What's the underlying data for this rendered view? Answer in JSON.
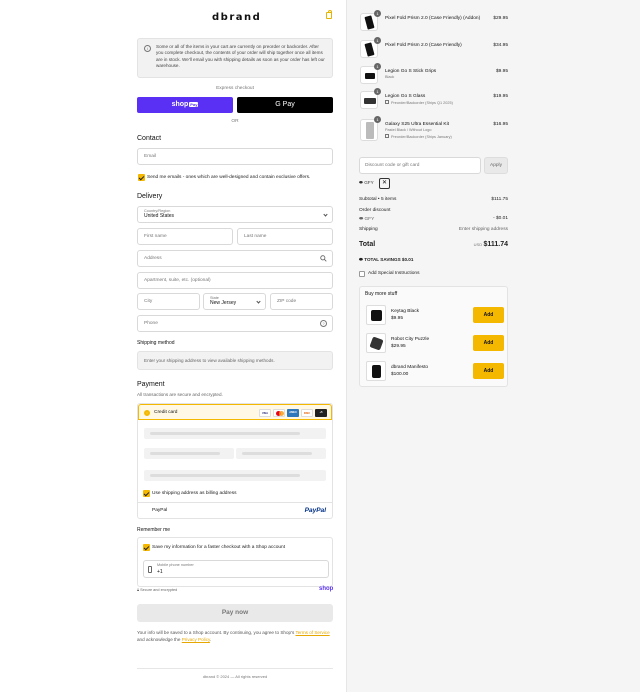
{
  "brand": {
    "logo": "dbrand",
    "accent": "#f5b800"
  },
  "notice": {
    "text": "Some or all of the items in your cart are currently on preorder or backorder. After you complete checkout, the contents of your order will ship together once all items are in stock. We'll email you with shipping details as soon as your order has left our warehouse."
  },
  "express": {
    "label": "Express checkout",
    "shop_pay": "shop",
    "shop_pay_badge": "Pay",
    "gpay": "G Pay",
    "or": "OR"
  },
  "contact": {
    "heading": "Contact",
    "email_placeholder": "Email",
    "newsletter_label": "Send me emails - ones which are well-designed and contain exclusive offers."
  },
  "delivery": {
    "heading": "Delivery",
    "country_label": "Country/Region",
    "country_value": "United States",
    "first_name": "First name",
    "last_name": "Last name",
    "address": "Address",
    "apartment": "Apartment, suite, etc. (optional)",
    "city": "City",
    "state_label": "State",
    "state_value": "New Jersey",
    "zip": "ZIP code",
    "phone": "Phone"
  },
  "shipping_method": {
    "heading": "Shipping method",
    "message": "Enter your shipping address to view available shipping methods."
  },
  "payment": {
    "heading": "Payment",
    "subtitle": "All transactions are secure and encrypted.",
    "credit_card": "Credit card",
    "cards": [
      "VISA",
      "MC",
      "AMEX",
      "DISC",
      "+5"
    ],
    "billing_same": "Use shipping address as billing address",
    "paypal": "PayPal",
    "paypal_logo": "PayPal"
  },
  "remember": {
    "heading": "Remember me",
    "save_label": "Save my information for a faster checkout with a Shop account",
    "mobile_label": "Mobile phone number",
    "mobile_value": "+1",
    "secure": "Secure and encrypted",
    "shop_logo": "shop"
  },
  "pay_now": "Pay now",
  "legal": {
    "text": "Your info will be saved to a Shop account. By continuing, you agree to Shop's ",
    "terms": "Terms of Service",
    "mid": " and acknowledge the ",
    "privacy": "Privacy Policy",
    "end": "."
  },
  "footer": "dbrand © 2024 — All rights reserved",
  "cart": {
    "items": [
      {
        "qty": "1",
        "name": "Pixel Fold Prism 2.0 (Case Friendly) (Addon)",
        "sub": "",
        "price": "$29.95"
      },
      {
        "qty": "1",
        "name": "Pixel Fold Prism 2.0 (Case Friendly)",
        "sub": "",
        "price": "$34.95"
      },
      {
        "qty": "1",
        "name": "Legion Go S Stick Grips",
        "sub": "Black",
        "price": "$9.95"
      },
      {
        "qty": "1",
        "name": "Legion Go S Glass",
        "sub": "Preorder/Backorder (Ships Q1 2025)",
        "price": "$19.95"
      },
      {
        "qty": "1",
        "name": "Galaxy S25 Ultra Essential Kit",
        "sub": "Pastel Black / Without Logo",
        "sub2": "Preorder/Backorder (Ships January)",
        "price": "$16.95"
      }
    ],
    "discount_placeholder": "Discount code or gift card",
    "apply": "Apply",
    "code": "GFY",
    "subtotal_label": "Subtotal • 5 items",
    "subtotal": "$111.75",
    "order_discount_label": "Order discount",
    "order_discount_code": "GFY",
    "order_discount": "- $0.01",
    "shipping_label": "Shipping",
    "shipping_value": "Enter shipping address",
    "total_label": "Total",
    "currency": "USD",
    "total": "$111.74",
    "savings_label": "TOTAL SAVINGS",
    "savings": "$0.01",
    "special_instructions": "Add Special Instructions"
  },
  "upsell": {
    "heading": "Buy more stuff",
    "items": [
      {
        "name": "Keytag Black",
        "price": "$9.95",
        "button": "Add"
      },
      {
        "name": "Robot City Puzzle",
        "price": "$29.95",
        "button": "Add"
      },
      {
        "name": "dbrand Manifesto",
        "price": "$100.00",
        "button": "Add"
      }
    ]
  }
}
